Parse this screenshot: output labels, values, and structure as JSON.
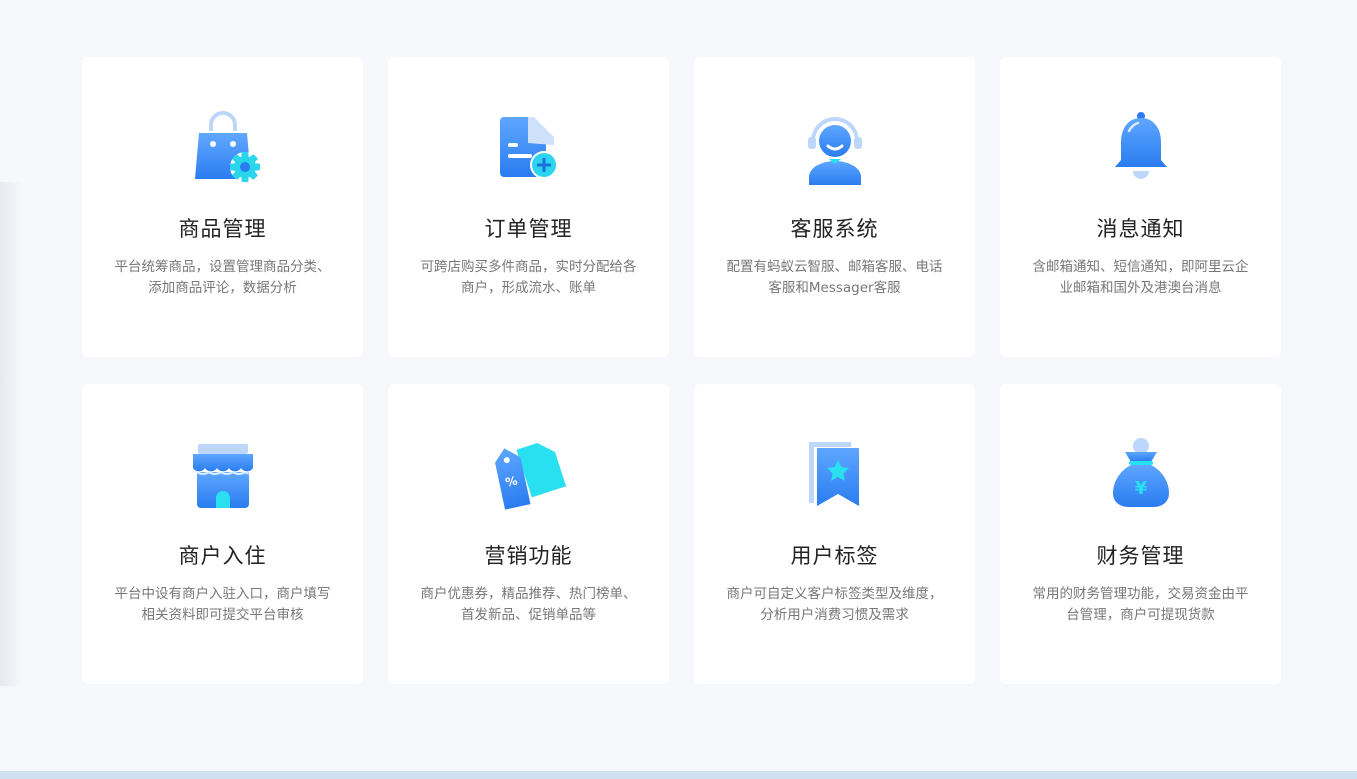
{
  "features": [
    {
      "title": "商品管理",
      "desc": "平台统筹商品，设置管理商品分类、添加商品评论，数据分析"
    },
    {
      "title": "订单管理",
      "desc": "可跨店购买多件商品，实时分配给各商户，形成流水、账单"
    },
    {
      "title": "客服系统",
      "desc": "配置有蚂蚁云智服、邮箱客服、电话客服和Messager客服"
    },
    {
      "title": "消息通知",
      "desc": "含邮箱通知、短信通知，即阿里云企业邮箱和国外及港澳台消息"
    },
    {
      "title": "商户入住",
      "desc": "平台中设有商户入驻入口，商户填写相关资料即可提交平台审核"
    },
    {
      "title": "营销功能",
      "desc": "商户优惠券，精品推荐、热门榜单、首发新品、促销单品等"
    },
    {
      "title": "用户标签",
      "desc": "商户可自定义客户标签类型及维度，分析用户消费习惯及需求"
    },
    {
      "title": "财务管理",
      "desc": "常用的财务管理功能，交易资金由平台管理，商户可提现货款"
    }
  ],
  "icons": [
    "shopping-bag-gear-icon",
    "document-add-icon",
    "headset-agent-icon",
    "bell-icon",
    "storefront-icon",
    "price-tags-icon",
    "bookmark-star-icon",
    "money-bag-icon"
  ],
  "colors": {
    "accent_blue": "#2f86f6",
    "accent_cyan": "#29e0f0",
    "light_blue": "#bcd7fb"
  }
}
